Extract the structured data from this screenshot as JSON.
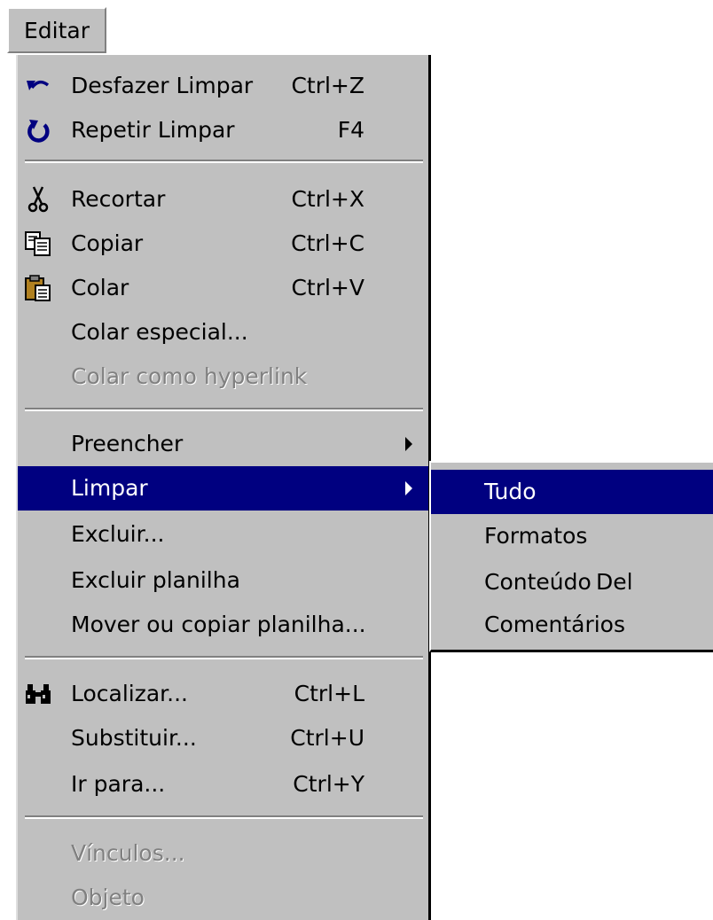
{
  "menubar": {
    "label": "Editar"
  },
  "menu": {
    "items": [
      {
        "label": "Desfazer Limpar",
        "shortcut": "Ctrl+Z",
        "icon": "undo-icon"
      },
      {
        "label": "Repetir Limpar",
        "shortcut": "F4",
        "icon": "redo-icon"
      },
      {
        "label": "Recortar",
        "shortcut": "Ctrl+X",
        "icon": "scissors-icon"
      },
      {
        "label": "Copiar",
        "shortcut": "Ctrl+C",
        "icon": "copy-icon"
      },
      {
        "label": "Colar",
        "shortcut": "Ctrl+V",
        "icon": "paste-icon"
      },
      {
        "label": "Colar especial..."
      },
      {
        "label": "Colar como hyperlink",
        "disabled": true
      },
      {
        "label": "Preencher",
        "submenu": true
      },
      {
        "label": "Limpar",
        "submenu": true,
        "highlighted": true
      },
      {
        "label": "Excluir..."
      },
      {
        "label": "Excluir planilha"
      },
      {
        "label": "Mover ou copiar planilha..."
      },
      {
        "label": "Localizar...",
        "shortcut": "Ctrl+L",
        "icon": "binoculars-icon"
      },
      {
        "label": "Substituir...",
        "shortcut": "Ctrl+U"
      },
      {
        "label": "Ir para...",
        "shortcut": "Ctrl+Y"
      },
      {
        "label": "Vínculos...",
        "disabled": true
      },
      {
        "label": "Objeto",
        "disabled": true
      }
    ]
  },
  "submenu": {
    "items": [
      {
        "label": "Tudo",
        "highlighted": true
      },
      {
        "label": "Formatos"
      },
      {
        "label": "Conteúdo",
        "shortcut": "Del"
      },
      {
        "label": "Comentários"
      }
    ]
  },
  "colors": {
    "menu_bg": "#c0c0c0",
    "highlight_bg": "#000080",
    "highlight_text": "#ffffff",
    "disabled_text": "#808080"
  }
}
